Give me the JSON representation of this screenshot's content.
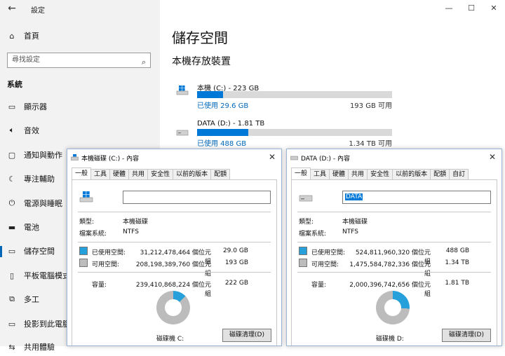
{
  "app": {
    "title": "設定",
    "back_icon": "back-arrow-icon"
  },
  "window_controls": {
    "minimize": "—",
    "maximize": "☐",
    "close": "✕"
  },
  "sidebar": {
    "home": "首頁",
    "search_placeholder": "尋找設定",
    "section": "系統",
    "items": [
      {
        "label": "顯示器",
        "icon": "monitor-icon"
      },
      {
        "label": "音效",
        "icon": "speaker-icon"
      },
      {
        "label": "通知與動作",
        "icon": "notification-icon"
      },
      {
        "label": "專注輔助",
        "icon": "moon-icon"
      },
      {
        "label": "電源與睡眠",
        "icon": "power-icon"
      },
      {
        "label": "電池",
        "icon": "battery-icon"
      },
      {
        "label": "儲存空間",
        "icon": "storage-icon",
        "selected": true
      },
      {
        "label": "平板電腦模式",
        "icon": "tablet-icon"
      },
      {
        "label": "多工",
        "icon": "multitask-icon"
      },
      {
        "label": "投影到此電腦",
        "icon": "project-icon"
      },
      {
        "label": "共用體驗",
        "icon": "share-icon"
      }
    ]
  },
  "main": {
    "title": "儲存空間",
    "subtitle": "本機存放裝置",
    "drives": [
      {
        "name": "本機 (C:) - 223 GB",
        "used": "已使用 29.6 GB",
        "free": "193 GB 可用",
        "used_fraction": 0.133
      },
      {
        "name": "DATA (D:) - 1.81 TB",
        "used": "已使用 488 GB",
        "free": "1.34 TB 可用",
        "used_fraction": 0.263
      }
    ]
  },
  "dialogs": [
    {
      "title": "本機磁碟 (C:) - 內容",
      "tabs": [
        "一般",
        "工具",
        "硬體",
        "共用",
        "安全性",
        "以前的版本",
        "配額"
      ],
      "name_value": "",
      "type_label": "類型:",
      "type_value": "本機磁碟",
      "fs_label": "檔案系統:",
      "fs_value": "NTFS",
      "used_label": "已使用空間:",
      "used_bytes": "31,212,478,464 個位元組",
      "used_size": "29.0 GB",
      "free_label": "可用空間:",
      "free_bytes": "208,198,389,760 個位元組",
      "free_size": "193 GB",
      "cap_label": "容量:",
      "cap_bytes": "239,410,868,224 個位元組",
      "cap_size": "222 GB",
      "drive_label": "磁碟機 C:",
      "cleanup": "磁碟清理(D)",
      "used_fraction": 0.13
    },
    {
      "title": "DATA (D:) - 內容",
      "tabs": [
        "一般",
        "工具",
        "硬體",
        "共用",
        "安全性",
        "以前的版本",
        "配額",
        "自訂"
      ],
      "name_value": "DATA",
      "type_label": "類型:",
      "type_value": "本機磁碟",
      "fs_label": "檔案系統:",
      "fs_value": "NTFS",
      "used_label": "已使用空間:",
      "used_bytes": "524,811,960,320 個位元組",
      "used_size": "488 GB",
      "free_label": "可用空間:",
      "free_bytes": "1,475,584,782,336 個位元組",
      "free_size": "1.34 TB",
      "cap_label": "容量:",
      "cap_bytes": "2,000,396,742,656 個位元組",
      "cap_size": "1.81 TB",
      "drive_label": "磁碟機 D:",
      "cleanup": "磁碟清理(D)",
      "used_fraction": 0.26
    }
  ],
  "colors": {
    "accent": "#0078d7",
    "used": "#26a0da",
    "free": "#bcbcbc"
  }
}
